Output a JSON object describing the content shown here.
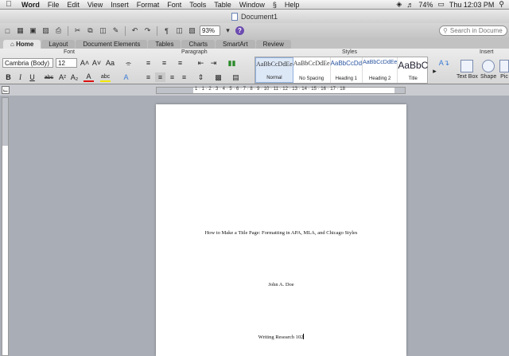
{
  "menubar": {
    "app": "Word",
    "items": [
      "File",
      "Edit",
      "View",
      "Insert",
      "Format",
      "Font",
      "Tools",
      "Table",
      "Window",
      "Help"
    ],
    "battery": "74%",
    "clock": "Thu 12:03 PM"
  },
  "window": {
    "title": "Document1"
  },
  "toolbar": {
    "zoom": "93%",
    "search_placeholder": "Search in Document",
    "help": "?"
  },
  "ribbon_tabs": [
    {
      "label": "Home",
      "active": true
    },
    {
      "label": "Layout"
    },
    {
      "label": "Document Elements"
    },
    {
      "label": "Tables"
    },
    {
      "label": "Charts"
    },
    {
      "label": "SmartArt"
    },
    {
      "label": "Review"
    }
  ],
  "ribbon": {
    "groups": {
      "font": "Font",
      "paragraph": "Paragraph",
      "styles": "Styles",
      "insert": "Insert"
    },
    "font_name": "Cambria (Body)",
    "font_size": "12",
    "styles": [
      {
        "sample": "AaBbCcDdEe",
        "name": "Normal"
      },
      {
        "sample": "AaBbCcDdEe",
        "name": "No Spacing"
      },
      {
        "sample": "AaBbCcDd",
        "name": "Heading 1"
      },
      {
        "sample": "AaBbCcDdEe",
        "name": "Heading 2"
      },
      {
        "sample": "AaBbC",
        "name": "Title"
      }
    ],
    "insert": {
      "text_box": "Text Box",
      "shape": "Shape",
      "picture": "Pic"
    }
  },
  "ruler": {
    "numbers": "1 · 1 · 2 · 3 · 4 · 5 · 6 · 7 · 8 · 9 · 10 · 11 · 12 · 13 · 14 · 15 · 16 · 17 · 18"
  },
  "document": {
    "title_line": "How to Make a Title Page: Formatting in APA, MLA, and Chicago Styles",
    "author": "John A. Doe",
    "course": "Writing Research 102"
  },
  "colors": {
    "accent": "#2b55a0",
    "page": "#ffffff",
    "workspace": "#a9adb5"
  }
}
